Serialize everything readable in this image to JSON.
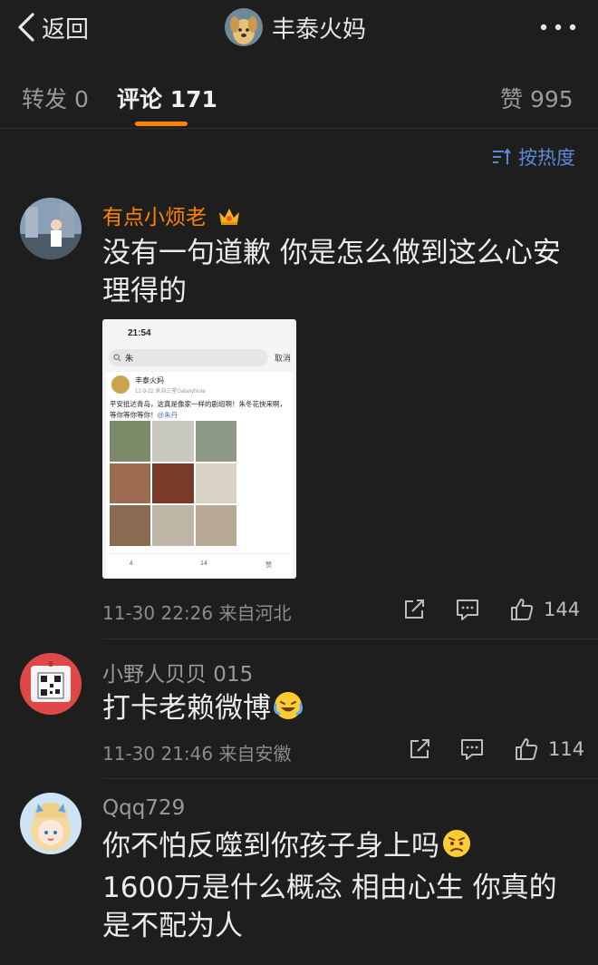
{
  "header": {
    "back_label": "返回",
    "title": "丰泰火妈"
  },
  "tabs": {
    "repost_label": "转发",
    "repost_count": "0",
    "comment_label": "评论",
    "comment_count": "171",
    "like_label": "赞",
    "like_count": "995"
  },
  "sort": {
    "label": "按热度"
  },
  "comments": [
    {
      "username": "有点小烦老",
      "text": "没有一句道歉 你是怎么做到这么心安理得的",
      "time": "11-30 22:26",
      "location": "来自河北",
      "likes": "144",
      "embedded": {
        "time": "21:54",
        "search_query": "朱",
        "cancel_label": "取消",
        "post_author": "丰泰火妈",
        "post_date": "12-9-22 来自三星GalaxyNote",
        "post_text": "平安抵达青岛，这真是像家一样的剧组啊！朱冬花快来啊，等你等你等你！",
        "post_mention": "@朱丹",
        "repost_count": "4",
        "comment_count": "14",
        "like_label": "赞"
      }
    },
    {
      "username": "小野人贝贝 015",
      "text": "打卡老赖微博",
      "time": "11-30 21:46",
      "location": "来自安徽",
      "likes": "114"
    },
    {
      "username": "Qqq729",
      "text": "你不怕反噬到你孩子身上吗",
      "text_line2": "1600万是什么概念 相由心生 你真的是不配为人"
    }
  ],
  "colors": {
    "background": "#1e1e1e",
    "accent": "#ff8200",
    "link_blue": "#5b89d4",
    "vip_name": "#ff8200"
  }
}
